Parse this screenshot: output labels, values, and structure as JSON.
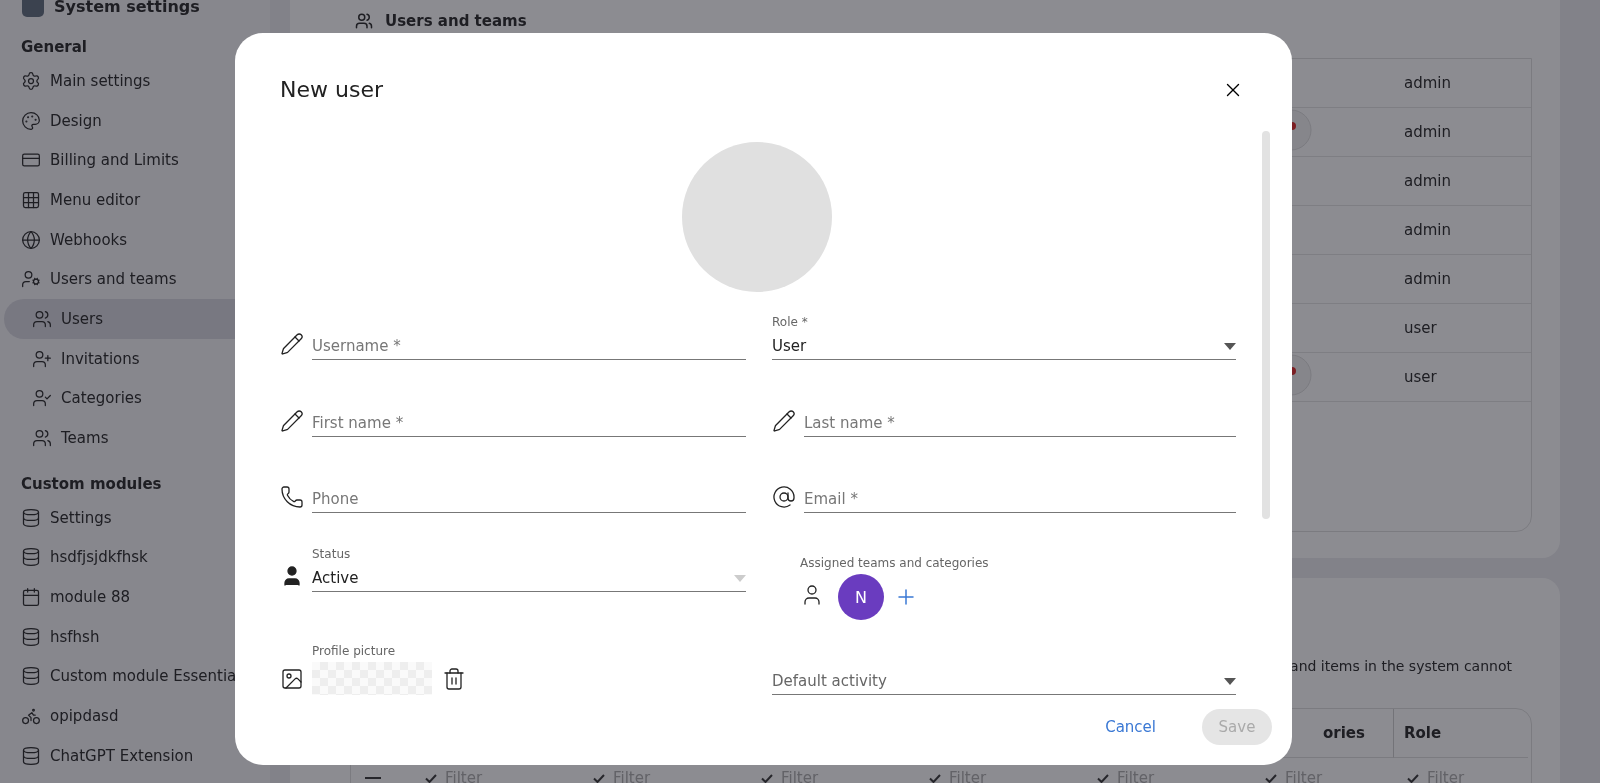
{
  "sidebar": {
    "title": "System settings",
    "sections": [
      {
        "heading": "General",
        "items": [
          {
            "label": "Main settings",
            "selected": false
          },
          {
            "label": "Design",
            "selected": false
          },
          {
            "label": "Billing and Limits",
            "selected": false
          },
          {
            "label": "Menu editor",
            "selected": false
          },
          {
            "label": "Webhooks",
            "selected": false
          },
          {
            "label": "Users and teams",
            "selected": false,
            "children": [
              {
                "label": "Users",
                "selected": true
              },
              {
                "label": "Invitations",
                "selected": false
              },
              {
                "label": "Categories",
                "selected": false
              },
              {
                "label": "Teams",
                "selected": false
              }
            ]
          }
        ]
      },
      {
        "heading": "Custom modules",
        "items": [
          {
            "label": "Settings",
            "selected": false
          },
          {
            "label": "hsdfjsjdkfhsk",
            "selected": false
          },
          {
            "label": "module 88",
            "selected": false
          },
          {
            "label": "hsfhsh",
            "selected": false
          },
          {
            "label": "Custom module Essentia",
            "selected": false
          },
          {
            "label": "opipdasd",
            "selected": false
          },
          {
            "label": "ChatGPT Extension",
            "selected": false
          }
        ]
      }
    ]
  },
  "users_card": {
    "title": "Users and teams",
    "rows": [
      {
        "role": "admin",
        "avatar": false
      },
      {
        "role": "admin",
        "avatar": true
      },
      {
        "role": "admin",
        "avatar": false
      },
      {
        "role": "admin",
        "avatar": false
      },
      {
        "role": "admin",
        "avatar": false
      },
      {
        "role": "user",
        "avatar": false
      },
      {
        "role": "user",
        "avatar": true
      }
    ]
  },
  "second_card": {
    "text": "and items in the system cannot",
    "columns": [
      "ories",
      "Role"
    ],
    "filters": [
      "Filter",
      "Filter",
      "Filter",
      "Filter",
      "Filter",
      "Filter",
      "Filter"
    ]
  },
  "dialog": {
    "title": "New user",
    "fields": [
      {
        "kind": "text",
        "placeholder": "Username *"
      },
      {
        "kind": "select",
        "label": "Role *",
        "value": "User"
      },
      {
        "kind": "text",
        "placeholder": "First name *"
      },
      {
        "kind": "text",
        "placeholder": "Last name *"
      },
      {
        "kind": "text",
        "placeholder": "Phone"
      },
      {
        "kind": "text",
        "placeholder": "Email *"
      },
      {
        "kind": "select",
        "label": "Status",
        "value": "Active"
      },
      {
        "kind": "chips",
        "label": "Assigned teams and categories",
        "chips": [
          {
            "initial": "N",
            "color": "#6a3cbf"
          }
        ]
      },
      {
        "kind": "picture",
        "label": "Profile picture"
      },
      {
        "kind": "select",
        "placeholder": "Default activity"
      }
    ],
    "cancel": "Cancel",
    "save": {
      "label": "Save",
      "disabled": true
    }
  }
}
